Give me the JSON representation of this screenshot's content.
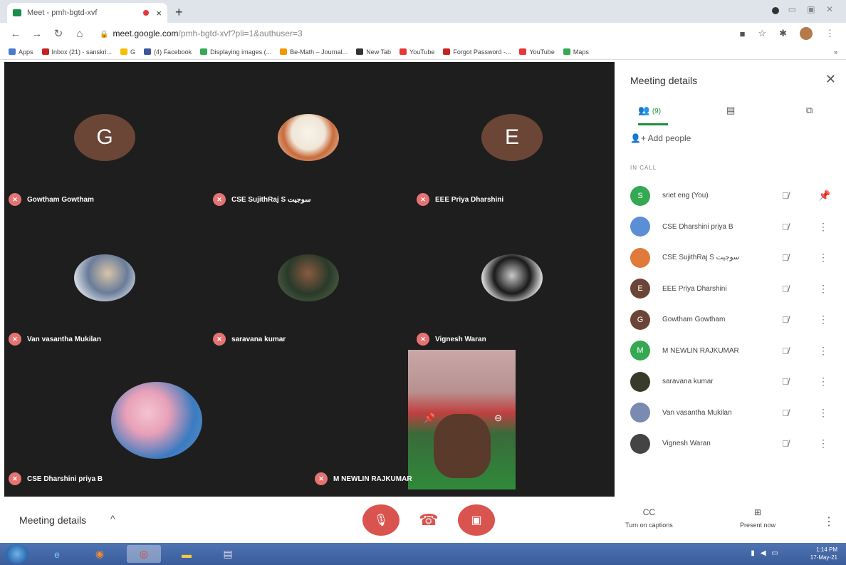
{
  "browser": {
    "tab_title": "Meet - pmh-bgtd-xvf",
    "tab_close": "×",
    "new_tab": "+",
    "window_controls": "▭ ▣ ✕",
    "url_main": "meet.google.com",
    "url_rest": "/pmh-bgtd-xvf?pli=1&authuser=3",
    "bookmarks": [
      "Apps",
      "Inbox (21) - sanskri...",
      "G",
      "(4) Facebook",
      "Displaying images (...",
      "Be-Math – Journal...",
      "New Tab",
      "YouTube",
      "Forgot Password -...",
      "YouTube",
      "Maps"
    ],
    "bookmarks_more": "»"
  },
  "tiles": [
    {
      "initial": "G",
      "name": "Gowtham Gowtham"
    },
    {
      "initial": "",
      "name": "CSE SujithRaj S سوجيت"
    },
    {
      "initial": "E",
      "name": "EEE Priya Dharshini"
    },
    {
      "initial": "",
      "name": "Van vasantha Mukilan"
    },
    {
      "initial": "",
      "name": "saravana kumar"
    },
    {
      "initial": "",
      "name": "Vignesh Waran"
    },
    {
      "initial": "",
      "name": "CSE Dharshini priya B"
    },
    {
      "initial": "",
      "name": "M NEWLIN RAJKUMAR"
    }
  ],
  "colors": {
    "avatar_brown": "#6b4636",
    "avatar_green": "#34a853",
    "mic_off_red": "#e57373",
    "control_red": "#d9544f",
    "accent_green": "#1e8e3e"
  },
  "panel": {
    "title": "Meeting details",
    "close": "✕",
    "people_count": "(9)",
    "add_people": "Add people",
    "in_call": "IN CALL",
    "participants": [
      {
        "initial": "S",
        "name": "sriet eng (You)",
        "color": "#34a853",
        "action": "pin"
      },
      {
        "initial": "",
        "name": "CSE Dharshini priya B",
        "color": "#5a8fd8",
        "action": "more"
      },
      {
        "initial": "",
        "name": "CSE SujithRaj S سوجيت",
        "color": "#e07a3a",
        "action": "more"
      },
      {
        "initial": "E",
        "name": "EEE Priya Dharshini",
        "color": "#6b4636",
        "action": "more"
      },
      {
        "initial": "G",
        "name": "Gowtham Gowtham",
        "color": "#6b4636",
        "action": "more"
      },
      {
        "initial": "M",
        "name": "M NEWLIN RAJKUMAR",
        "color": "#34a853",
        "action": "more"
      },
      {
        "initial": "",
        "name": "saravana kumar",
        "color": "#3a3a2a",
        "action": "more"
      },
      {
        "initial": "",
        "name": "Van vasantha Mukilan",
        "color": "#7a8ab0",
        "action": "more"
      },
      {
        "initial": "",
        "name": "Vignesh Waran",
        "color": "#444444",
        "action": "more"
      }
    ]
  },
  "bottom": {
    "meeting_details": "Meeting details",
    "chevron": "^",
    "captions": "Turn on captions",
    "captions_icon": "CC",
    "present": "Present now",
    "present_icon": "⊞",
    "more": "⋮"
  },
  "taskbar": {
    "time": "1:14 PM",
    "date": "17-May-21"
  }
}
